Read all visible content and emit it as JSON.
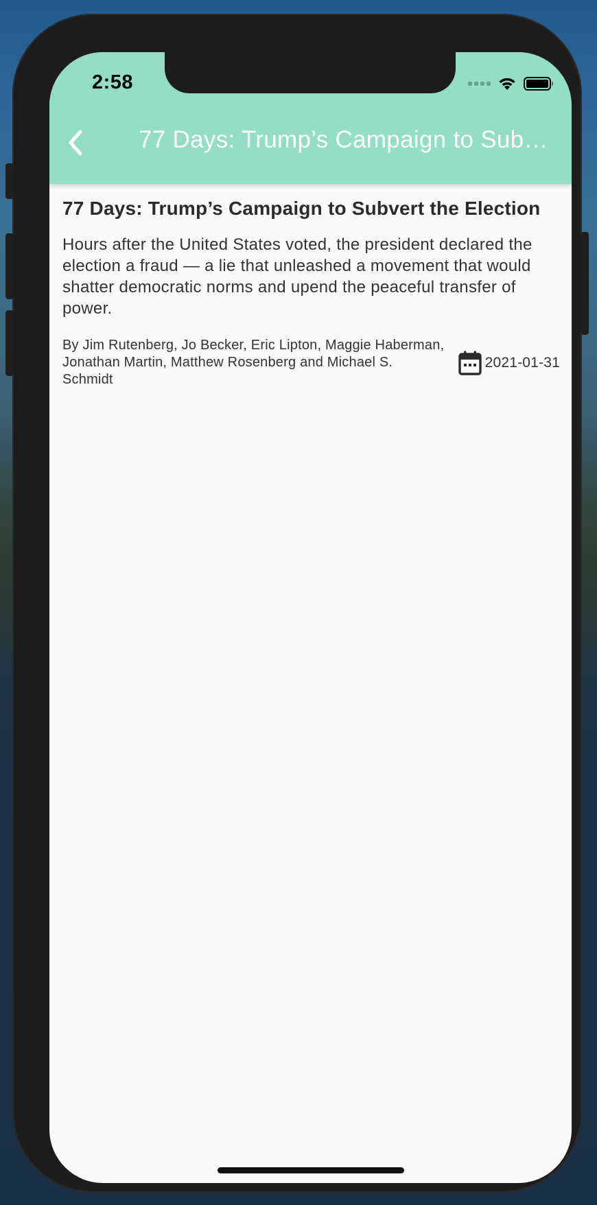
{
  "status_bar": {
    "time": "2:58",
    "icons": [
      "signal-icon",
      "wifi-icon",
      "battery-icon"
    ]
  },
  "app_bar": {
    "back_icon": "chevron-left-icon",
    "title": "77 Days: Trump’s Campaign to Subvert the Election",
    "background_color": "#93dec4",
    "title_color": "#ffffff"
  },
  "article": {
    "title": "77 Days: Trump’s Campaign to Subvert the Election",
    "summary": "Hours after the United States voted, the president declared the election a fraud — a lie that unleashed a movement that would shatter democratic norms and upend the peaceful transfer of power.",
    "byline": "By Jim Rutenberg, Jo Becker, Eric Lipton, Maggie Haberman, Jonathan Martin, Matthew Rosenberg and Michael S. Schmidt",
    "date_icon": "calendar-icon",
    "date": "2021-01-31"
  }
}
